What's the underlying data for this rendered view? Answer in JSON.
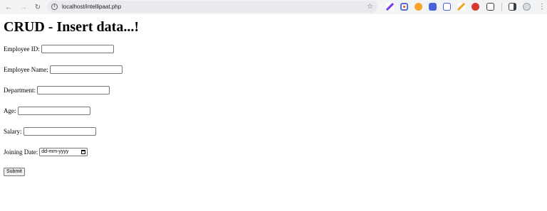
{
  "browser": {
    "url": "localhost/intellipaat.php"
  },
  "page": {
    "heading": "CRUD - Insert data...!",
    "fields": [
      {
        "label": "Employee ID:",
        "value": ""
      },
      {
        "label": "Employee Name:",
        "value": ""
      },
      {
        "label": "Department:",
        "value": ""
      },
      {
        "label": "Age:",
        "value": ""
      },
      {
        "label": "Salary:",
        "value": ""
      }
    ],
    "joining": {
      "label": "Joining Date:",
      "placeholder": "dd-mm-yyyy"
    },
    "submit_label": "Submit"
  }
}
